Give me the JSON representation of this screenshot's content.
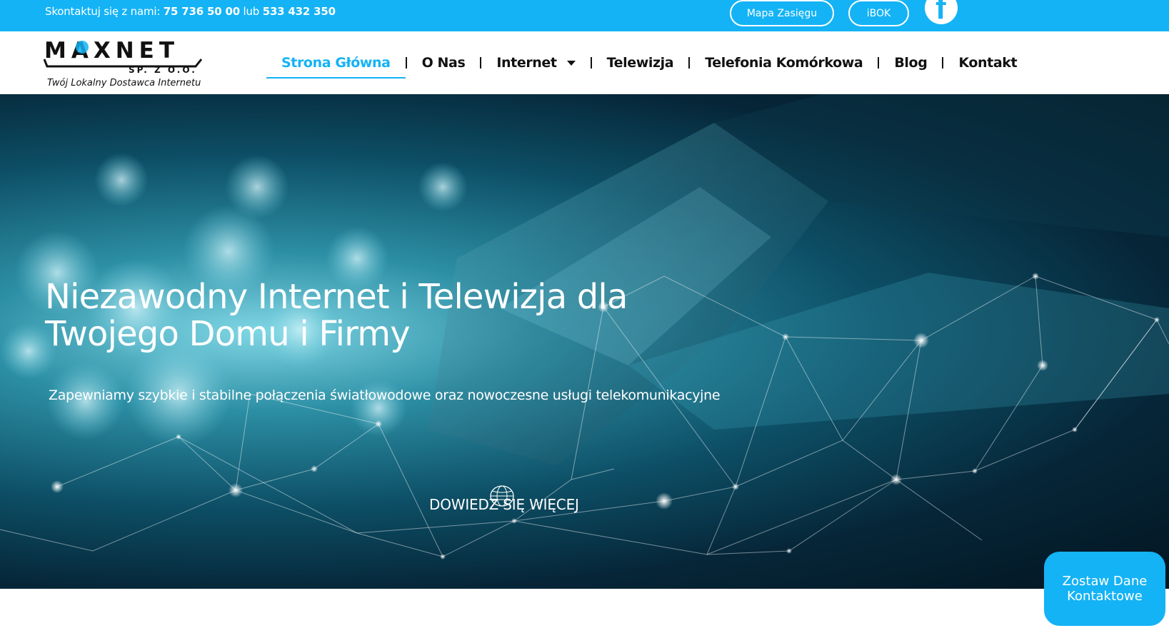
{
  "topbar": {
    "contact_prefix": "Skontaktuj się z nami: ",
    "phone_1": "75 736 50 00",
    "contact_or": " lub ",
    "phone_2": "533 432 350",
    "coverage_map_label": "Mapa Zasięgu",
    "ibok_label": "iBOK",
    "social_icon": "facebook-icon",
    "accent_color": "#14b3f5"
  },
  "logo": {
    "brand": "MAXNET",
    "company_suffix": "SP. Z O.O.",
    "tagline": "Twój Lokalny Dostawca Internetu"
  },
  "nav": {
    "items": [
      {
        "label": "Strona Główna",
        "active": true
      },
      {
        "label": "O Nas"
      },
      {
        "label": "Internet",
        "has_dropdown": true
      },
      {
        "label": "Telewizja"
      },
      {
        "label": "Telefonia Komórkowa"
      },
      {
        "label": "Blog"
      },
      {
        "label": "Kontakt"
      }
    ]
  },
  "hero": {
    "title": "Niezawodny Internet i Telewizja dla Twojego Domu i Firmy",
    "subtitle": "Zapewniamy szybkie i stabilne połączenia światłowodowe oraz nowoczesne usługi telekomunikacyjne",
    "button_label": "DOWIEDZ SIĘ WIĘCEJ"
  },
  "cta": {
    "label": "Zostaw Dane Kontaktowe"
  }
}
